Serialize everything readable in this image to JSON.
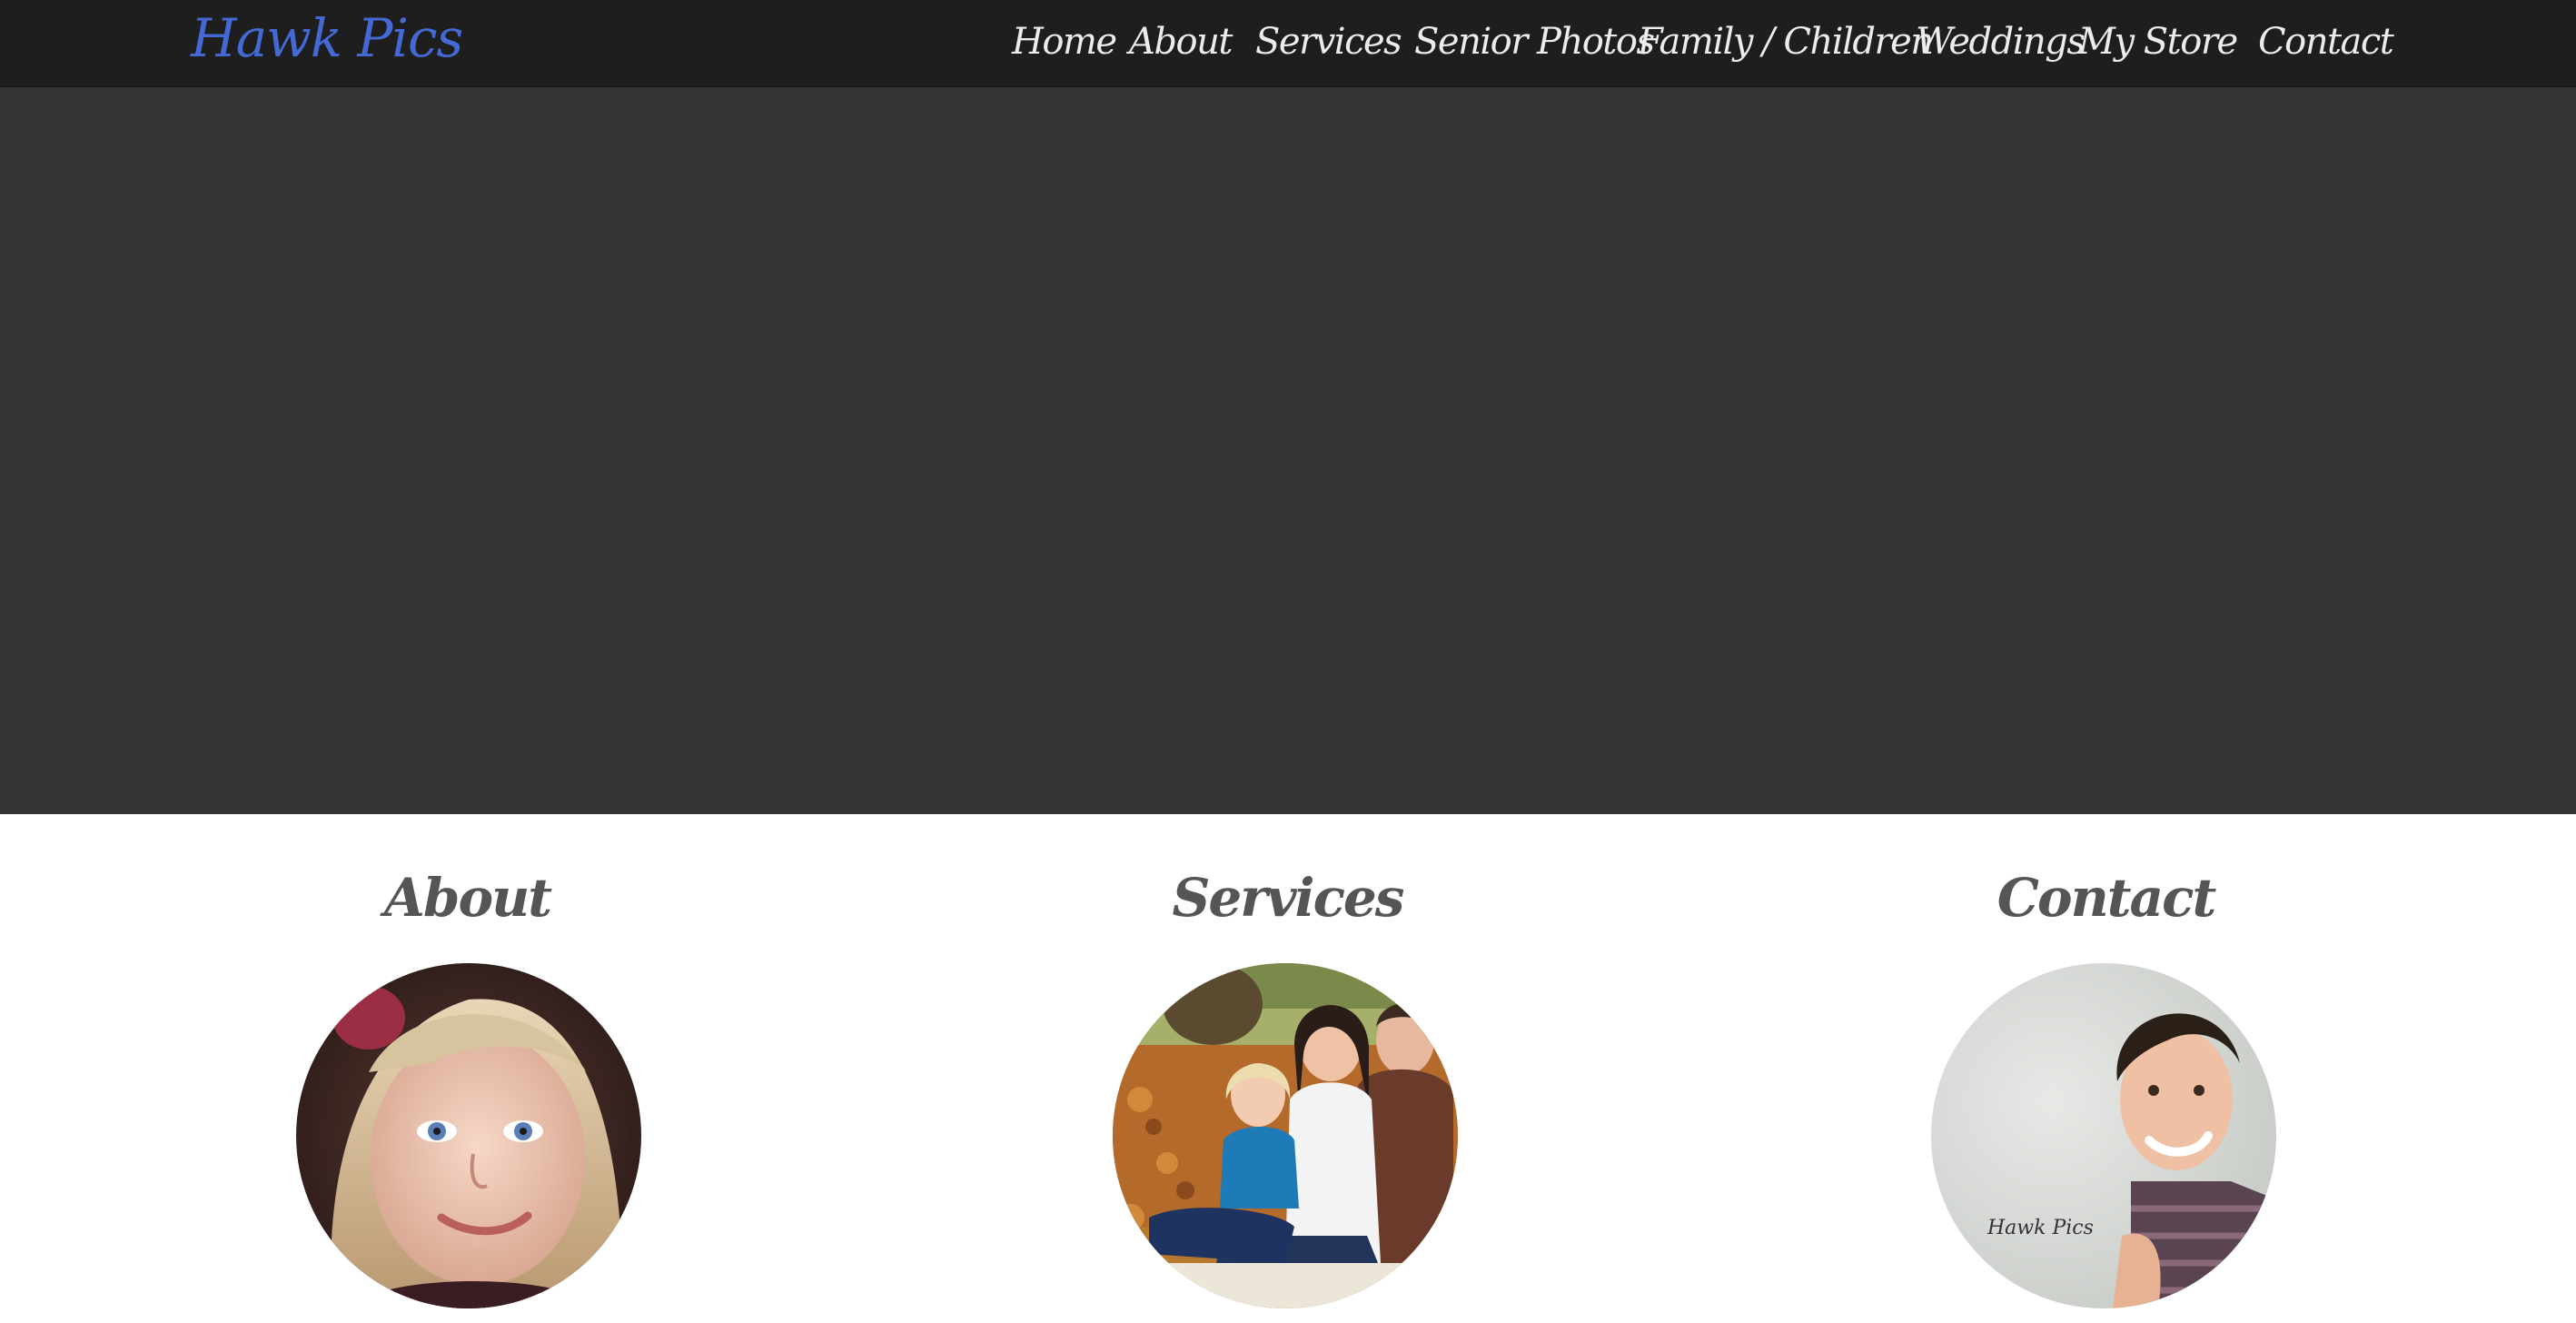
{
  "header": {
    "brand": "Hawk Pics",
    "nav": [
      {
        "label": "Home"
      },
      {
        "label": "About"
      },
      {
        "label": "Services"
      },
      {
        "label": "Senior Photos"
      },
      {
        "label": "Family / Children"
      },
      {
        "label": "Weddings"
      },
      {
        "label": "My Store"
      },
      {
        "label": "Contact"
      }
    ]
  },
  "sections": [
    {
      "title": "About",
      "image": "girl-portrait-photo"
    },
    {
      "title": "Services",
      "image": "family-autumn-photo"
    },
    {
      "title": "Contact",
      "image": "senior-boy-portrait-photo",
      "watermark": "Hawk Pics"
    }
  ],
  "colors": {
    "brand": "#4569d4",
    "nav_bg": "#1e1e1e",
    "hero_bg": "#333333",
    "heading": "#555555"
  }
}
